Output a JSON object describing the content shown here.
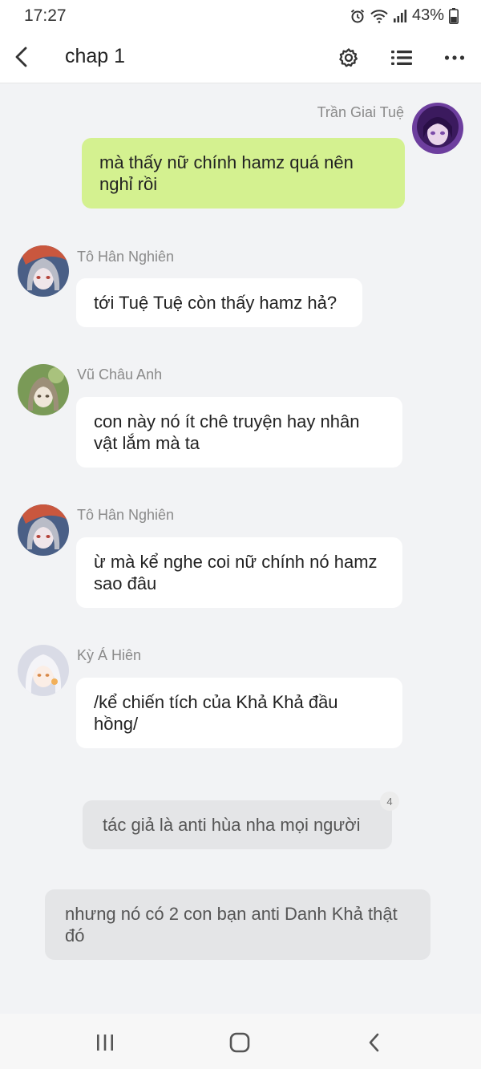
{
  "status_bar": {
    "time": "17:27",
    "battery": "43%",
    "icons": [
      "alarm-icon",
      "wifi-icon",
      "signal-icon",
      "battery-icon"
    ]
  },
  "header": {
    "title": "chap 1",
    "icons": [
      "back-arrow-icon",
      "settings-gear-icon",
      "list-icon",
      "more-dots-icon"
    ]
  },
  "messages": [
    {
      "sender": "Trần Giai Tuệ",
      "text": "mà thấy nữ chính hamz quá nên nghỉ rồi",
      "side": "right"
    },
    {
      "sender": "Tô Hân Nghiên",
      "text": "tới Tuệ Tuệ còn thấy hamz hả?",
      "side": "left"
    },
    {
      "sender": "Vũ Châu Anh",
      "text": "con này nó ít chê truyện hay nhân vật lắm mà ta",
      "side": "left"
    },
    {
      "sender": "Tô Hân Nghiên",
      "text": "ừ mà kể nghe coi nữ chính nó hamz sao đâu",
      "side": "left"
    },
    {
      "sender": "Kỳ Á Hiên",
      "text": "/kể chiến tích của Khả Khả đầu hồng/",
      "side": "left"
    }
  ],
  "narration": [
    {
      "text": "tác giả là anti hùa nha mọi người",
      "badge": "4"
    },
    {
      "text": "nhưng nó có 2 con bạn anti Danh Khả thật đó"
    }
  ],
  "colors": {
    "outgoing_bubble": "#d4f190",
    "incoming_bubble": "#ffffff",
    "narration_bubble": "#e4e5e7",
    "background": "#f2f3f5"
  },
  "nav_bar": {
    "icons": [
      "recent-apps-icon",
      "home-icon",
      "back-icon"
    ]
  }
}
